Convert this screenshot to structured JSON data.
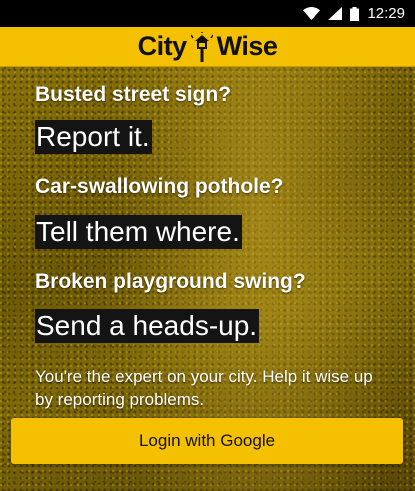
{
  "status_bar": {
    "time": "12:29",
    "icons": [
      "wifi-icon",
      "cell-signal-icon",
      "battery-icon"
    ]
  },
  "header": {
    "logo_left": "City",
    "logo_right": "Wise",
    "logo_icon": "street-lamp-icon",
    "background_color": "#f5c000"
  },
  "hero": {
    "prompts": [
      {
        "question": "Busted street sign?",
        "action": "Report it."
      },
      {
        "question": "Car-swallowing pothole?",
        "action": "Tell them where."
      },
      {
        "question": "Broken playground swing?",
        "action": "Send a heads-up."
      }
    ],
    "intro": "You're the expert on your city. Help it wise up by reporting problems."
  },
  "login": {
    "label": "Login with Google",
    "color": "#f5c000"
  }
}
